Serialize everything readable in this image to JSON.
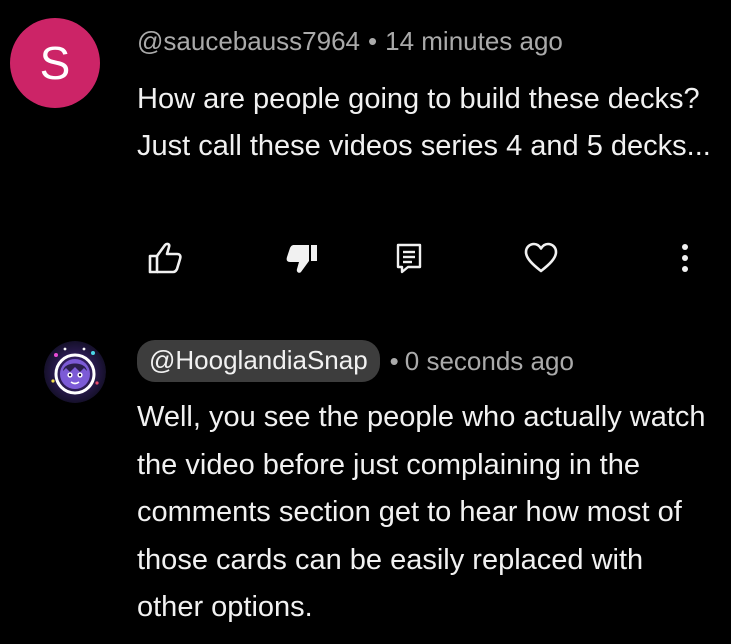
{
  "comments": [
    {
      "avatar_letter": "S",
      "avatar_color": "#cc2467",
      "handle": "@saucebauss7964",
      "separator": "•",
      "time": "14 minutes ago",
      "text": "How are people going to build these decks? Just call these videos series 4 and 5 decks...",
      "actions": {
        "like_icon": "thumbs-up-icon",
        "dislike_icon": "thumbs-down-icon",
        "reply_icon": "reply-icon",
        "heart_icon": "heart-icon",
        "more_icon": "more-vertical-icon"
      }
    },
    {
      "handle": "@HooglandiaSnap",
      "separator": "•",
      "time": "0 seconds ago",
      "text": "Well, you see the people who actually watch the video before just complaining in the comments section get to hear how most of those cards can be easily replaced with other options."
    }
  ],
  "colors": {
    "background": "#000000",
    "text": "#f1f1f1",
    "meta": "#aaaaaa",
    "pill": "#3d3d3d"
  }
}
